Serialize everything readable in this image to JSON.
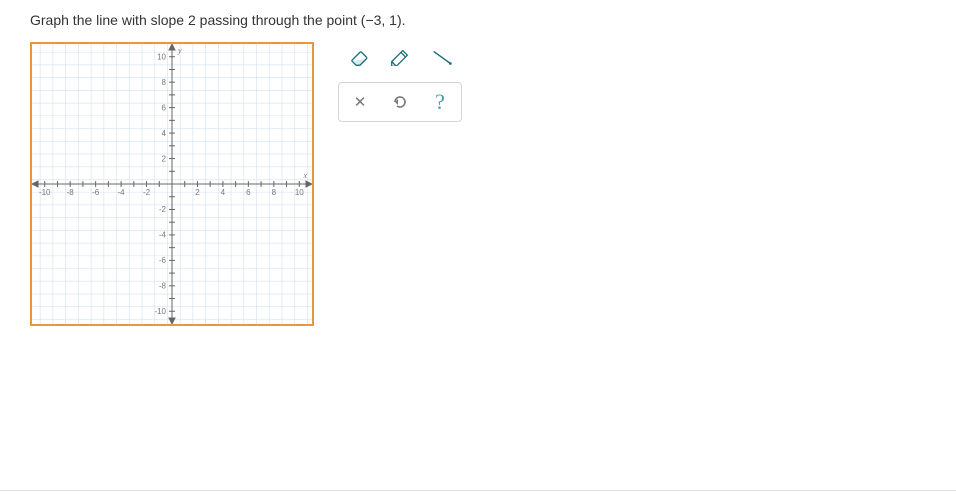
{
  "problem": {
    "prefix": "Graph the line with slope 2 passing through the point ",
    "point": "(−3, 1)",
    "suffix": "."
  },
  "toolbar": {
    "row1": [
      {
        "name": "eraser-icon",
        "symbol": "eraser"
      },
      {
        "name": "pencil-icon",
        "symbol": "pencil"
      },
      {
        "name": "line-icon",
        "symbol": "line"
      }
    ],
    "row2": [
      {
        "name": "clear-button",
        "symbol": "✕"
      },
      {
        "name": "undo-button",
        "symbol": "undo"
      },
      {
        "name": "help-button",
        "symbol": "?"
      }
    ]
  },
  "chart_data": {
    "type": "scatter",
    "title": "",
    "xlabel": "x",
    "ylabel": "y",
    "xlim": [
      -11,
      11
    ],
    "ylim": [
      -11,
      11
    ],
    "xticks": [
      -10,
      -8,
      -6,
      -4,
      -2,
      2,
      4,
      6,
      8,
      10
    ],
    "yticks": [
      -10,
      -8,
      -6,
      -4,
      -2,
      2,
      4,
      6,
      8,
      10
    ],
    "grid": true,
    "series": []
  }
}
